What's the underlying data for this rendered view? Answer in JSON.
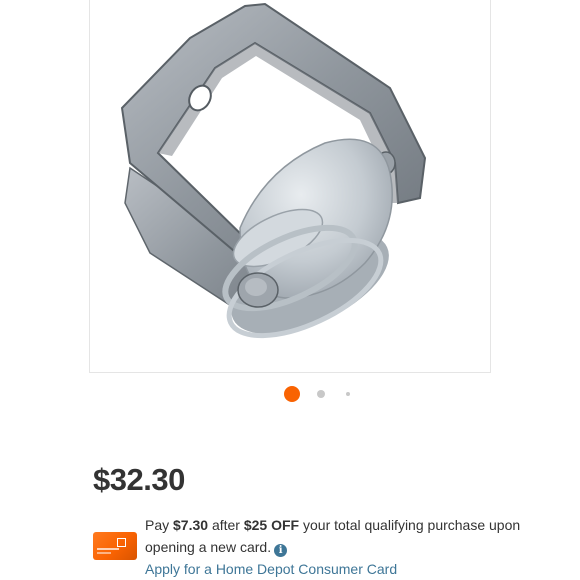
{
  "product": {
    "image_alt": "Galvanized bracket with porcelain spool insulator",
    "carousel": {
      "total_dots": 3,
      "active_index": 0,
      "active_color": "#f96302",
      "inactive_color": "#c8c8c8"
    }
  },
  "pricing": {
    "price": "$32.30"
  },
  "financing": {
    "card_icon": "home-depot-credit-card-icon",
    "text_pay": "Pay",
    "text_savings_amount": "$7.30",
    "text_after": "after",
    "text_discount": "$25 OFF",
    "text_rest_line1": "your total qualifying",
    "text_line2": "purchase upon opening a new card.",
    "info_glyph": "i",
    "apply_link": "Apply for a Home Depot Consumer Card",
    "link_color": "#3e7697",
    "brand_color": "#f96302"
  }
}
